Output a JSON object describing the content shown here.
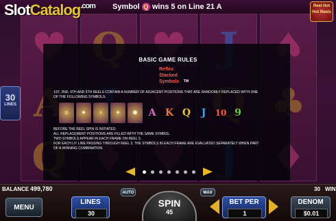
{
  "header": {
    "logo_main": "Slot",
    "logo_accent": "Catalog",
    "logo_com": ".com",
    "win_prefix": "Symbol",
    "win_symbol": "Q",
    "win_suffix": "wins 5 on Line 21 A",
    "game_logo": "Reel Hot Hot Reels"
  },
  "reels": {
    "side_lines_number": "30",
    "side_lines_label": "LINES"
  },
  "rules_panel": {
    "title": "BASIC GAME RULES",
    "logo_line1": "Reflex",
    "logo_line2": "Stacked",
    "logo_line3": "Symbols",
    "logo_tm": "TM",
    "paragraph_line1": "1ST, 2ND, 4TH AND 5TH REELS CONTAIN A NUMBER OF ADJACENT POSITIONS THAT ARE RANDOMLY REPLACED WITH ONE",
    "paragraph_line2": "OF THE FOLLOWING SYMBOLS:",
    "symbols": [
      "mask",
      "bird",
      "dancer",
      "bird2",
      "feather",
      "A",
      "K",
      "Q",
      "J",
      "10",
      "9"
    ],
    "rule_1": "BEFORE THE REEL SPIN IS INITIATED.",
    "rule_2": "ALL  REPLACEMENT POSITIONS ARE FILLED WITH THE SAME SYMBOL.",
    "rule_3": "TWO SYMBOLS APPEAR IN EACH FRAME ON REEL 3.",
    "rule_4": "FOR EACH LIT LINE PASSING THROUGH REEL 3, THE SYMBOLS IN EACH FRAME ARE EVALUATED SEPARATELY WHEN PART",
    "rule_5": "OF A WINNING COMBINATION.",
    "pages_total": 7,
    "page_active": 1
  },
  "bottom": {
    "balance_label": "BALANCE",
    "balance_value": "499,780",
    "auto_label": "AUTO",
    "max_label": "MAX",
    "win_lines_value": "30",
    "win_label": "WIN",
    "menu_label": "MENU",
    "lines_label": "LINES",
    "lines_value": "30",
    "spin_label": "SPIN",
    "spin_value": "45",
    "bet_per_label": "BET PER",
    "bet_per_value": "1",
    "denom_label": "DENOM",
    "denom_value": "$0.01"
  }
}
